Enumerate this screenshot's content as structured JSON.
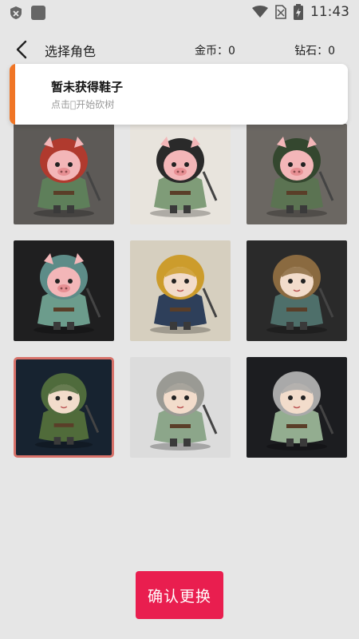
{
  "status_bar": {
    "time": "11:43"
  },
  "header": {
    "title": "选择角色",
    "gold_label": "金币：0",
    "diamond_label": "钻石：0"
  },
  "toast": {
    "title": "暂未获得鞋子",
    "subtitle": "点击\u0000开始砍树"
  },
  "characters": [
    {
      "id": 1,
      "bg": "#5d5a57",
      "hood": "#b03a2e",
      "body": "#5e7f5a",
      "face": "pig",
      "selected": false
    },
    {
      "id": 2,
      "bg": "#e8e4dd",
      "hood": "#2a2a2a",
      "body": "#7f9c78",
      "face": "pig",
      "selected": false
    },
    {
      "id": 3,
      "bg": "#6b6762",
      "hood": "#34472f",
      "body": "#5b7352",
      "face": "pig",
      "selected": false
    },
    {
      "id": 4,
      "bg": "#1f1f20",
      "hood": "#5d8c88",
      "body": "#6c9c8c",
      "face": "pig",
      "selected": false
    },
    {
      "id": 5,
      "bg": "#d6cfbf",
      "hood": "#cc9c2c",
      "body": "#2e3f5a",
      "face": "human",
      "selected": false
    },
    {
      "id": 6,
      "bg": "#2a2a2a",
      "hood": "#8a6a40",
      "body": "#4e6f6a",
      "face": "human",
      "selected": false
    },
    {
      "id": 7,
      "bg": "#172330",
      "hood": "#4f6b3c",
      "body": "#506b3a",
      "face": "human",
      "selected": true
    },
    {
      "id": 8,
      "bg": "#dcdcdc",
      "hood": "#9a9a94",
      "body": "#8ca68a",
      "face": "human",
      "selected": false
    },
    {
      "id": 9,
      "bg": "#1c1d20",
      "hood": "#a9a9a9",
      "body": "#93ad90",
      "face": "human",
      "selected": false
    }
  ],
  "confirm_button": {
    "label": "确认更换"
  },
  "colors": {
    "accent": "#e91e4f",
    "toast_bar": "#f07525",
    "selected_border": "#d8726a"
  }
}
